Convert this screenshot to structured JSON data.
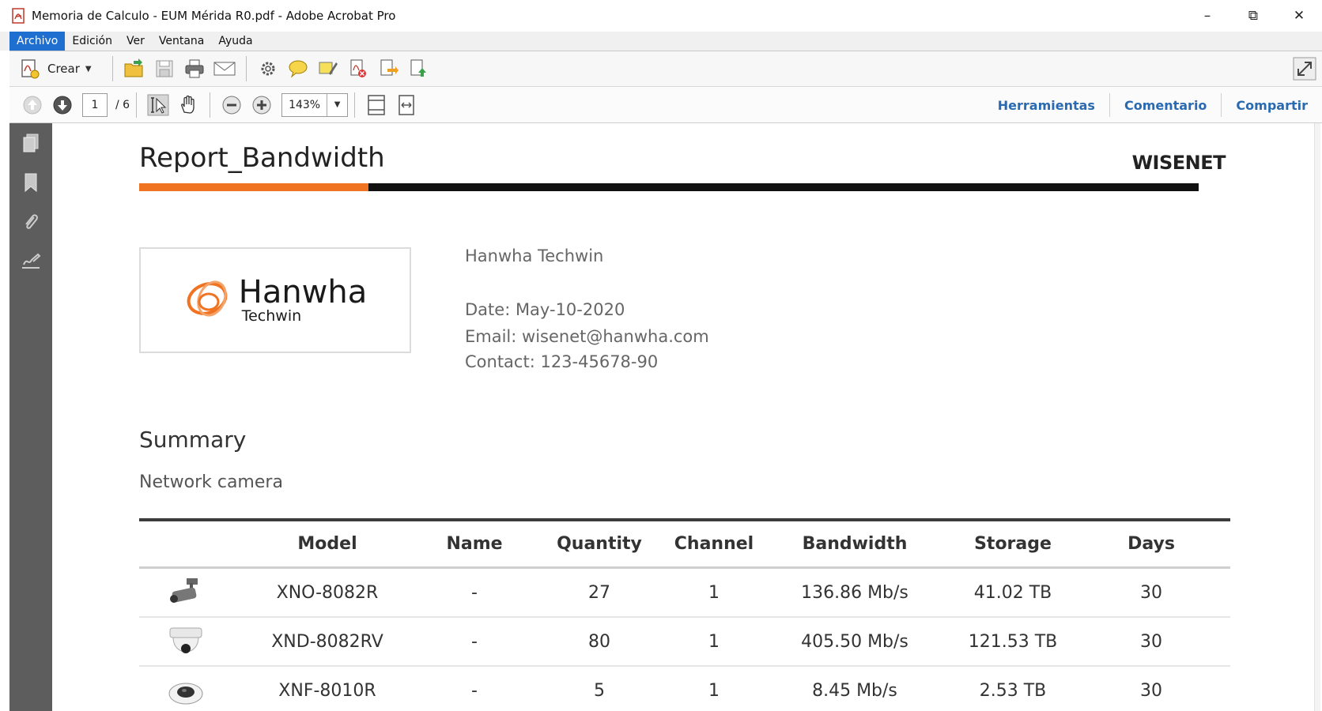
{
  "window": {
    "title": "Memoria de Calculo - EUM Mérida R0.pdf - Adobe Acrobat Pro",
    "minimize": "–",
    "restore": "⧉",
    "close": "✕"
  },
  "menu": [
    "Archivo",
    "Edición",
    "Ver",
    "Ventana",
    "Ayuda"
  ],
  "toolbar": {
    "crear_label": "Crear"
  },
  "navigation": {
    "current_page": "1",
    "total_pages": "/ 6",
    "zoom": "143%"
  },
  "right_tabs": [
    "Herramientas",
    "Comentario",
    "Compartir"
  ],
  "document": {
    "title": "Report_Bandwidth",
    "brand": "WISENET",
    "logo_main": "Hanwha",
    "logo_sub": "Techwin",
    "company": "Hanwha Techwin",
    "date": "Date: May-10-2020",
    "email": "Email: wisenet@hanwha.com",
    "contact": "Contact: 123-45678-90",
    "summary_heading": "Summary",
    "section_subtitle": "Network camera",
    "table": {
      "headers": [
        "Model",
        "Name",
        "Quantity",
        "Channel",
        "Bandwidth",
        "Storage",
        "Days"
      ],
      "rows": [
        {
          "icon": "bullet-camera-icon",
          "model": "XNO-8082R",
          "name": "-",
          "quantity": "27",
          "channel": "1",
          "bandwidth": "136.86 Mb/s",
          "storage": "41.02 TB",
          "days": "30"
        },
        {
          "icon": "dome-camera-icon",
          "model": "XND-8082RV",
          "name": "-",
          "quantity": "80",
          "channel": "1",
          "bandwidth": "405.50 Mb/s",
          "storage": "121.53 TB",
          "days": "30"
        },
        {
          "icon": "fisheye-camera-icon",
          "model": "XNF-8010R",
          "name": "-",
          "quantity": "5",
          "channel": "1",
          "bandwidth": "8.45 Mb/s",
          "storage": "2.53 TB",
          "days": "30"
        }
      ]
    }
  },
  "colors": {
    "accent_orange": "#f07322",
    "menu_active": "#1f6fd1",
    "tab_blue": "#2a6ab0",
    "sidebar": "#5d5d5d"
  }
}
